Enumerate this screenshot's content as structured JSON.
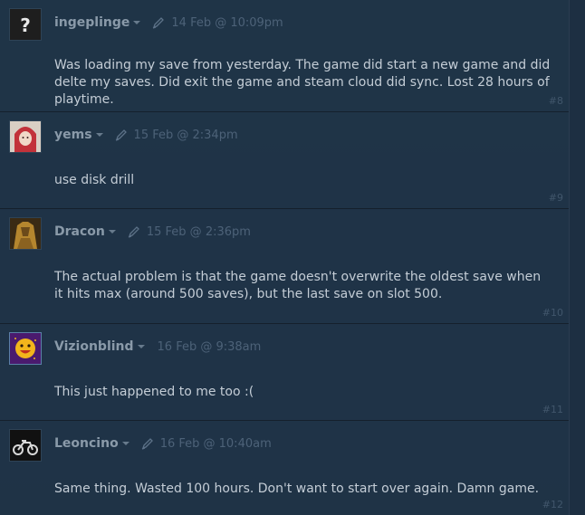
{
  "comments": [
    {
      "author": "ingeplinge",
      "timestamp": "14 Feb @ 10:09pm",
      "body": "Was loading my save from yesterday. The game did start a new game and did delte my saves. Did exit the game and steam cloud did sync. Lost 28 hours of playtime.",
      "number": "#8",
      "avatar": "question-mark-avatar-icon"
    },
    {
      "author": "yems",
      "timestamp": "15 Feb @ 2:34pm",
      "body": "use disk drill",
      "number": "#9",
      "avatar": "red-hood-avatar-icon"
    },
    {
      "author": "Dracon",
      "timestamp": "15 Feb @ 2:36pm",
      "body": "The actual problem is that the game doesn't overwrite the oldest save when it hits max (around 500 saves), but the last save on slot 500.",
      "number": "#10",
      "avatar": "armored-figure-avatar-icon"
    },
    {
      "author": "Vizionblind",
      "timestamp": "16 Feb @ 9:38am",
      "body": "This just happened to me too :(",
      "number": "#11",
      "avatar": "smiley-sun-avatar-icon"
    },
    {
      "author": "Leoncino",
      "timestamp": "16 Feb @ 10:40am",
      "body": "Same thing. Wasted 100 hours. Don't want to start over again. Damn game.",
      "number": "#12",
      "avatar": "motorcycle-avatar-icon"
    }
  ],
  "colors": {
    "background": "#1b2838",
    "panel": "#1f3448",
    "author": "#8a9aa9",
    "timestamp": "#4d6278",
    "body_text": "#c4cdd6"
  }
}
